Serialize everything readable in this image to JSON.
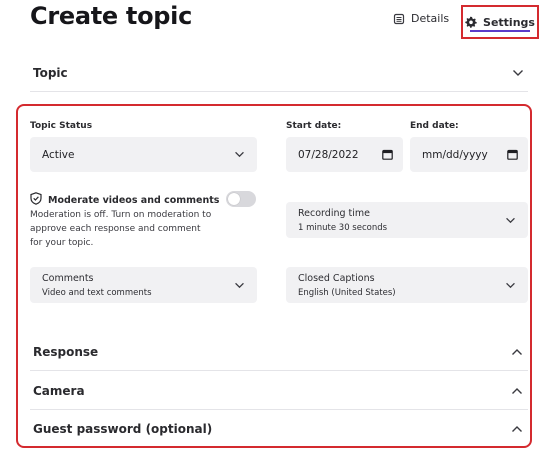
{
  "page": {
    "title": "Create topic"
  },
  "tabs": {
    "details": "Details",
    "settings": "Settings"
  },
  "topic_section": {
    "label": "Topic"
  },
  "settings": {
    "topic_status": {
      "label": "Topic Status",
      "value": "Active"
    },
    "start_date": {
      "label": "Start date:",
      "value": "07/28/2022"
    },
    "end_date": {
      "label": "End date:",
      "value": "mm/dd/yyyy"
    },
    "moderation": {
      "title": "Moderate videos and comments",
      "description": "Moderation is off. Turn on moderation to approve each response and comment for your topic.",
      "enabled": false
    },
    "recording_time": {
      "label": "Recording time",
      "value": "1 minute 30 seconds"
    },
    "comments": {
      "label": "Comments",
      "value": "Video and text comments"
    },
    "closed_captions": {
      "label": "Closed Captions",
      "value": "English (United States)"
    }
  },
  "accordions": [
    {
      "label": "Response"
    },
    {
      "label": "Camera"
    },
    {
      "label": "Guest password (optional)"
    }
  ],
  "colors": {
    "highlight": "#d42a2f",
    "accent": "#5b3bc9",
    "field_bg": "#f1f1f3"
  },
  "icons": {
    "details": "details-icon",
    "settings": "gear-icon",
    "moderation": "shield-check-icon"
  }
}
